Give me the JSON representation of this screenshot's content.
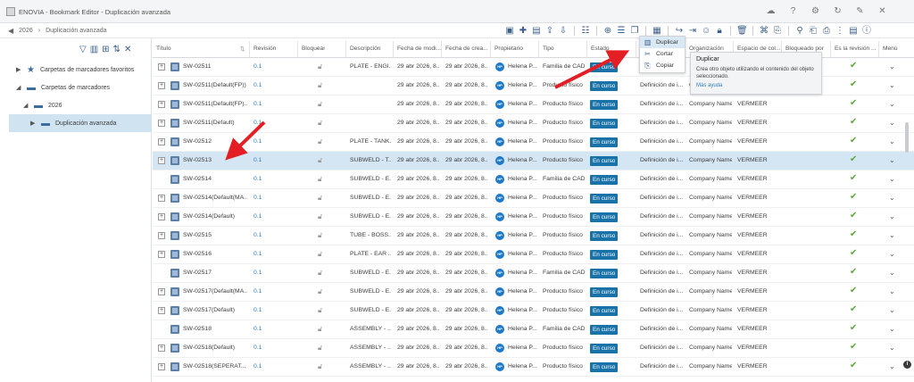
{
  "window": {
    "title": "ENOVIA - Bookmark Editor - Duplicación avanzada"
  },
  "breadcrumb": {
    "year": "2026",
    "current": "Duplicación avanzada"
  },
  "tree": [
    {
      "label": "Carpetas de marcadores favoritos",
      "icon": "star-icon"
    },
    {
      "label": "Carpetas de marcadores",
      "icon": "folder-icon"
    },
    {
      "label": "2026",
      "icon": "folder-icon"
    },
    {
      "label": "Duplicación avanzada",
      "icon": "folder-icon"
    }
  ],
  "columns": [
    "Título",
    "Revisión",
    "Bloquear",
    "Descripción",
    "Fecha de modi...",
    "Fecha de crea...",
    "Propietario",
    "Tipo",
    "Estado",
    "",
    "Organización",
    "Espacio de col...",
    "Bloqueado por",
    "Es la revisión ...",
    "Menú"
  ],
  "rows": [
    {
      "title": "SW-02511",
      "rev": "0.1",
      "desc": "PLATE - ENGI...",
      "mod": "29 abr 2026, 8...",
      "cre": "29 abr 2026, 8...",
      "owner": "Helena P...",
      "type": "Familia de CAD",
      "state": "En curso",
      "maturity": "",
      "org": "",
      "space": "",
      "plus": true,
      "selected": false
    },
    {
      "title": "SW-02511(Default(FP))",
      "rev": "0.1",
      "desc": "",
      "mod": "29 abr 2026, 8...",
      "cre": "29 abr 2026, 8...",
      "owner": "Helena P...",
      "type": "Producto físico",
      "state": "En curso",
      "maturity": "Definición de i...",
      "org": "Company Name",
      "space": "VERMEER",
      "plus": true,
      "selected": false
    },
    {
      "title": "SW-02511(Default(FP)...",
      "rev": "0.1",
      "desc": "",
      "mod": "29 abr 2026, 8...",
      "cre": "29 abr 2026, 8...",
      "owner": "Helena P...",
      "type": "Producto físico",
      "state": "En curso",
      "maturity": "Definición de i...",
      "org": "Company Name",
      "space": "VERMEER",
      "plus": true,
      "selected": false
    },
    {
      "title": "SW-02511(Default)",
      "rev": "0.1",
      "desc": "",
      "mod": "29 abr 2026, 8...",
      "cre": "29 abr 2026, 8...",
      "owner": "Helena P...",
      "type": "Producto físico",
      "state": "En curso",
      "maturity": "Definición de i...",
      "org": "Company Name",
      "space": "VERMEER",
      "plus": true,
      "selected": false
    },
    {
      "title": "SW-02512",
      "rev": "0.1",
      "desc": "PLATE - TANK...",
      "mod": "29 abr 2026, 8...",
      "cre": "29 abr 2026, 8...",
      "owner": "Helena P...",
      "type": "Producto físico",
      "state": "En curso",
      "maturity": "Definición de i...",
      "org": "Company Name",
      "space": "VERMEER",
      "plus": true,
      "selected": false
    },
    {
      "title": "SW-02513",
      "rev": "0.1",
      "desc": "SUBWELD - T...",
      "mod": "29 abr 2026, 8...",
      "cre": "29 abr 2026, 8...",
      "owner": "Helena P...",
      "type": "Producto físico",
      "state": "En curso",
      "maturity": "Definición de i...",
      "org": "Company Name",
      "space": "VERMEER",
      "plus": true,
      "selected": true
    },
    {
      "title": "SW-02514",
      "rev": "0.1",
      "desc": "SUBWELD - E...",
      "mod": "29 abr 2026, 8...",
      "cre": "29 abr 2026, 8...",
      "owner": "Helena P...",
      "type": "Familia de CAD",
      "state": "En curso",
      "maturity": "Definición de i...",
      "org": "Company Name",
      "space": "VERMEER",
      "plus": false,
      "selected": false
    },
    {
      "title": "SW-02514(Default(MA...",
      "rev": "0.1",
      "desc": "SUBWELD - E...",
      "mod": "29 abr 2026, 8...",
      "cre": "29 abr 2026, 8...",
      "owner": "Helena P...",
      "type": "Producto físico",
      "state": "En curso",
      "maturity": "Definición de i...",
      "org": "Company Name",
      "space": "VERMEER",
      "plus": true,
      "selected": false
    },
    {
      "title": "SW-02514(Default)",
      "rev": "0.1",
      "desc": "SUBWELD - E...",
      "mod": "29 abr 2026, 8...",
      "cre": "29 abr 2026, 8...",
      "owner": "Helena P...",
      "type": "Producto físico",
      "state": "En curso",
      "maturity": "Definición de i...",
      "org": "Company Name",
      "space": "VERMEER",
      "plus": true,
      "selected": false
    },
    {
      "title": "SW-02515",
      "rev": "0.1",
      "desc": "TUBE - BOSS...",
      "mod": "29 abr 2026, 8...",
      "cre": "29 abr 2026, 8...",
      "owner": "Helena P...",
      "type": "Producto físico",
      "state": "En curso",
      "maturity": "Definición de i...",
      "org": "Company Name",
      "space": "VERMEER",
      "plus": true,
      "selected": false
    },
    {
      "title": "SW-02516",
      "rev": "0.1",
      "desc": "PLATE - EAR ...",
      "mod": "29 abr 2026, 8...",
      "cre": "29 abr 2026, 8...",
      "owner": "Helena P...",
      "type": "Producto físico",
      "state": "En curso",
      "maturity": "Definición de i...",
      "org": "Company Name",
      "space": "VERMEER",
      "plus": true,
      "selected": false
    },
    {
      "title": "SW-02517",
      "rev": "0.1",
      "desc": "SUBWELD - E...",
      "mod": "29 abr 2026, 8...",
      "cre": "29 abr 2026, 8...",
      "owner": "Helena P...",
      "type": "Familia de CAD",
      "state": "En curso",
      "maturity": "Definición de i...",
      "org": "Company Name",
      "space": "VERMEER",
      "plus": false,
      "selected": false
    },
    {
      "title": "SW-02517(Default(MA...",
      "rev": "0.1",
      "desc": "SUBWELD - E...",
      "mod": "29 abr 2026, 8...",
      "cre": "29 abr 2026, 8...",
      "owner": "Helena P...",
      "type": "Producto físico",
      "state": "En curso",
      "maturity": "Definición de i...",
      "org": "Company Name",
      "space": "VERMEER",
      "plus": true,
      "selected": false
    },
    {
      "title": "SW-02517(Default)",
      "rev": "0.1",
      "desc": "SUBWELD - E...",
      "mod": "29 abr 2026, 8...",
      "cre": "29 abr 2026, 8...",
      "owner": "Helena P...",
      "type": "Producto físico",
      "state": "En curso",
      "maturity": "Definición de i...",
      "org": "Company Name",
      "space": "VERMEER",
      "plus": true,
      "selected": false
    },
    {
      "title": "SW-02518",
      "rev": "0.1",
      "desc": "ASSEMBLY - ...",
      "mod": "29 abr 2026, 8...",
      "cre": "29 abr 2026, 8...",
      "owner": "Helena P...",
      "type": "Familia de CAD",
      "state": "En curso",
      "maturity": "Definición de i...",
      "org": "Company Name",
      "space": "VERMEER",
      "plus": false,
      "selected": false
    },
    {
      "title": "SW-02518(Default)",
      "rev": "0.1",
      "desc": "ASSEMBLY - ...",
      "mod": "29 abr 2026, 8...",
      "cre": "29 abr 2026, 8...",
      "owner": "Helena P...",
      "type": "Producto físico",
      "state": "En curso",
      "maturity": "Definición de i...",
      "org": "Company Name",
      "space": "VERMEER",
      "plus": true,
      "selected": false
    },
    {
      "title": "SW-02518(SEPERAT...",
      "rev": "0.1",
      "desc": "ASSEMBLY - ...",
      "mod": "29 abr 2026, 8...",
      "cre": "29 abr 2026, 8...",
      "owner": "Helena P...",
      "type": "Producto físico",
      "state": "En curso",
      "maturity": "Definición de i...",
      "org": "Company Name",
      "space": "VERMEER",
      "plus": true,
      "selected": false
    }
  ],
  "owner_initials": "HP",
  "dropdown": {
    "items": [
      "Duplicar",
      "Cortar",
      "Copiar"
    ]
  },
  "tooltip": {
    "title": "Duplicar",
    "description": "Crea otro objeto utilizando el contenido del objeto seleccionado.",
    "link": "Más ayuda"
  },
  "colors": {
    "accent": "#2f7cbf",
    "state_badge": "#1a73a8",
    "arrow": "#e31e24",
    "check": "#5aa83a",
    "selection": "#d4e6f3"
  }
}
